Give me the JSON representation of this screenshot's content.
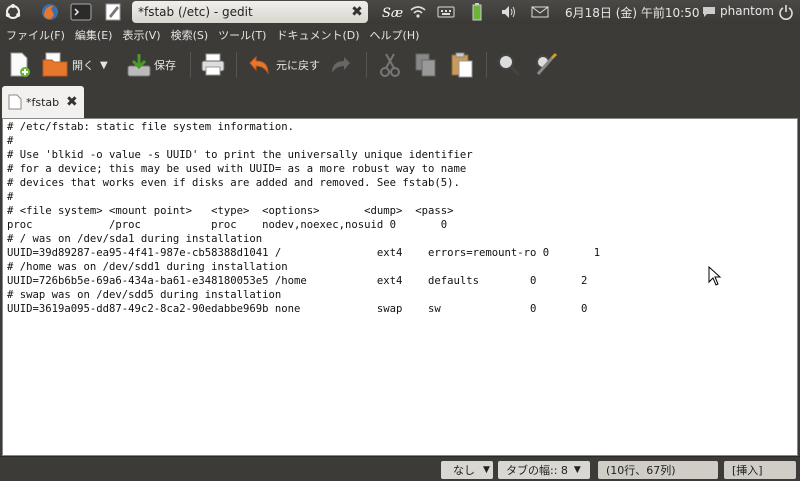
{
  "panel": {
    "window_title": "*fstab (/etc) - gedit",
    "datetime": "6月18日 (金) 午前10:50",
    "user": "phantom",
    "icons": [
      "ubuntu-logo-icon",
      "firefox-icon",
      "terminal-icon",
      "gedit-icon",
      "input-method-icon",
      "wifi-icon",
      "keyboard-icon",
      "battery-icon",
      "volume-icon",
      "mail-icon",
      "power-icon"
    ]
  },
  "menu": {
    "file": "ファイル(F)",
    "edit": "編集(E)",
    "view": "表示(V)",
    "search": "検索(S)",
    "tools": "ツール(T)",
    "documents": "ドキュメント(D)",
    "help": "ヘルプ(H)"
  },
  "toolbar": {
    "open": "開く",
    "save": "保存",
    "undo": "元に戻す"
  },
  "tab": {
    "label": "*fstab"
  },
  "editor": {
    "content": "# /etc/fstab: static file system information.\n#\n# Use 'blkid -o value -s UUID' to print the universally unique identifier\n# for a device; this may be used with UUID= as a more robust way to name\n# devices that works even if disks are added and removed. See fstab(5).\n#\n# <file system> <mount point>   <type>  <options>       <dump>  <pass>\nproc            /proc           proc    nodev,noexec,nosuid 0       0\n# / was on /dev/sda1 during installation\nUUID=39d89287-ea95-4f41-987e-cb58388d1041 /               ext4    errors=remount-ro 0       1\n# /home was on /dev/sdd1 during installation\nUUID=726b6b5e-69a6-434a-ba61-e348180053e5 /home           ext4    defaults        0       2\n# swap was on /dev/sdd5 during installation\nUUID=3619a095-dd87-49c2-8ca2-90edabbe969b none            swap    sw              0       0"
  },
  "status": {
    "highlight": "なし",
    "tab_width": "タブの幅:: 8",
    "position": "(10行、67列)",
    "mode": "[挿入]"
  }
}
